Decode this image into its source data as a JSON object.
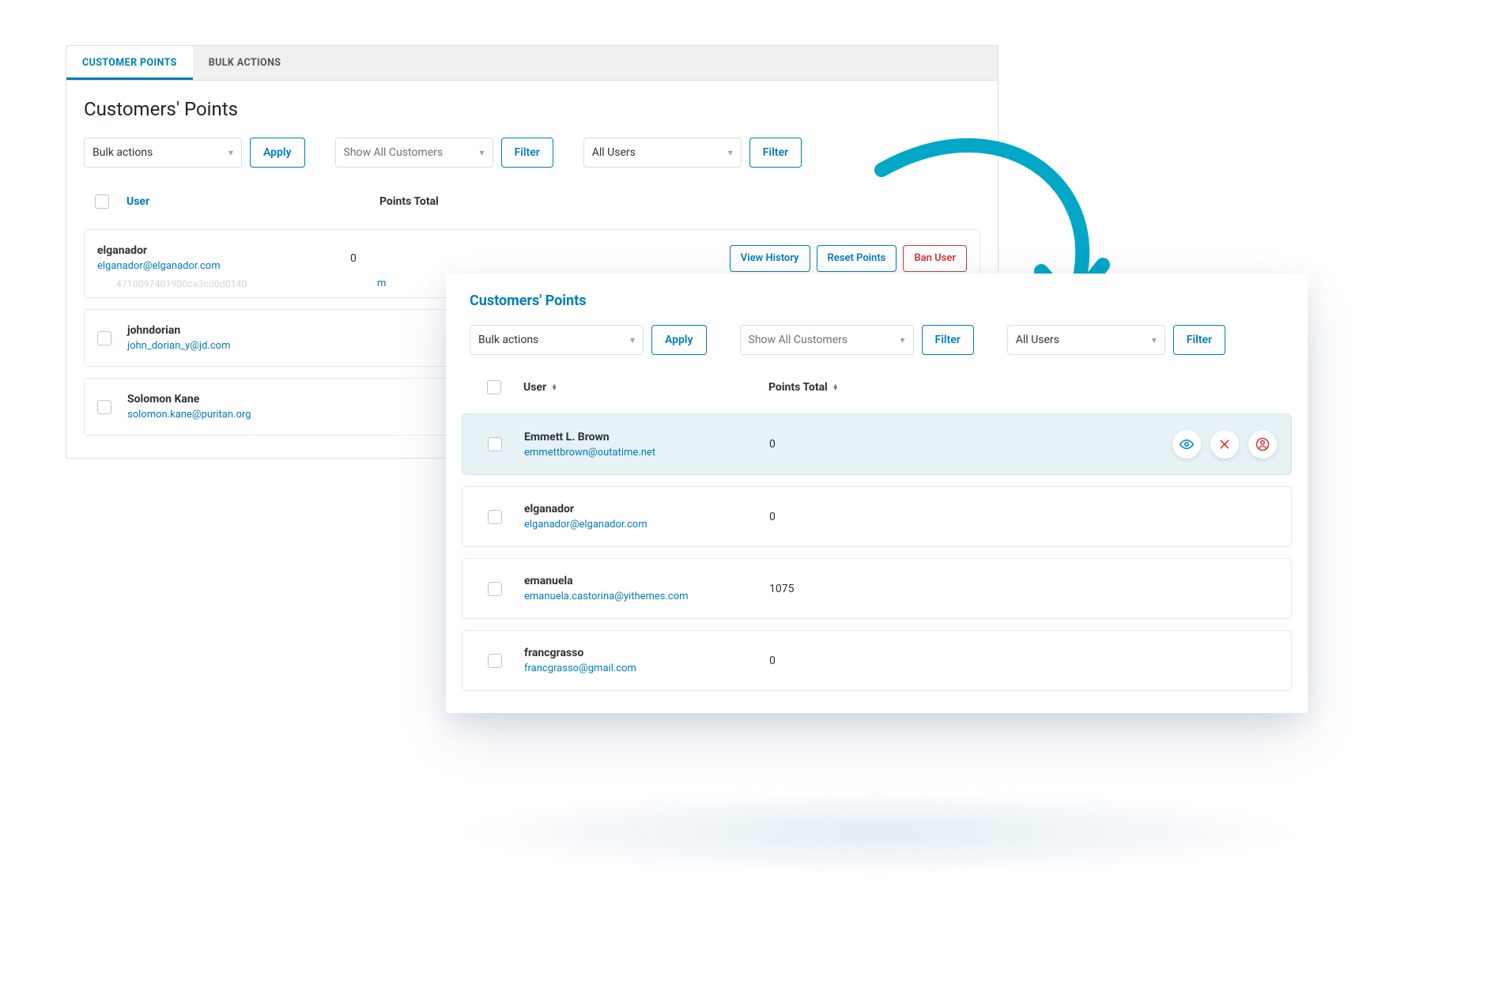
{
  "colors": {
    "accent": "#007cba",
    "teal": "#00a7c7",
    "danger": "#d63638"
  },
  "tabs": {
    "customer_points": "CUSTOMER POINTS",
    "bulk_actions": "BULK ACTIONS"
  },
  "panel1": {
    "title": "Customers' Points",
    "bulk_select": "Bulk actions",
    "apply": "Apply",
    "customers_select": "Show All Customers",
    "filter1": "Filter",
    "users_select": "All Users",
    "filter2": "Filter",
    "head": {
      "user": "User",
      "points": "Points Total"
    },
    "row1": {
      "name": "elganador",
      "email": "elganador@elganador.com",
      "points": "0",
      "artifact_line": "4710097401900ca3cd0d0140",
      "artifact_m": "m",
      "actions": {
        "view": "View History",
        "reset": "Reset Points",
        "ban": "Ban User"
      }
    },
    "row2": {
      "name": "johndorian",
      "email": "john_dorian_y@jd.com"
    },
    "row3": {
      "name": "Solomon Kane",
      "email": "solomon.kane@puritan.org"
    }
  },
  "panel2": {
    "title": "Customers' Points",
    "bulk_select": "Bulk actions",
    "apply": "Apply",
    "customers_select": "Show All Customers",
    "filter1": "Filter",
    "users_select": "All Users",
    "filter2": "Filter",
    "head": {
      "user": "User",
      "points": "Points Total"
    },
    "rows": [
      {
        "name": "Emmett L. Brown",
        "email": "emmettbrown@outatime.net",
        "points": "0",
        "hover": true
      },
      {
        "name": "elganador",
        "email": "elganador@elganador.com",
        "points": "0",
        "hover": false
      },
      {
        "name": "emanuela",
        "email": "emanuela.castorina@yithemes.com",
        "points": "1075",
        "hover": false
      },
      {
        "name": "francgrasso",
        "email": "francgrasso@gmail.com",
        "points": "0",
        "hover": false
      }
    ],
    "icons": {
      "view": "eye-icon",
      "reset": "close-icon",
      "ban": "user-ban-icon"
    }
  }
}
